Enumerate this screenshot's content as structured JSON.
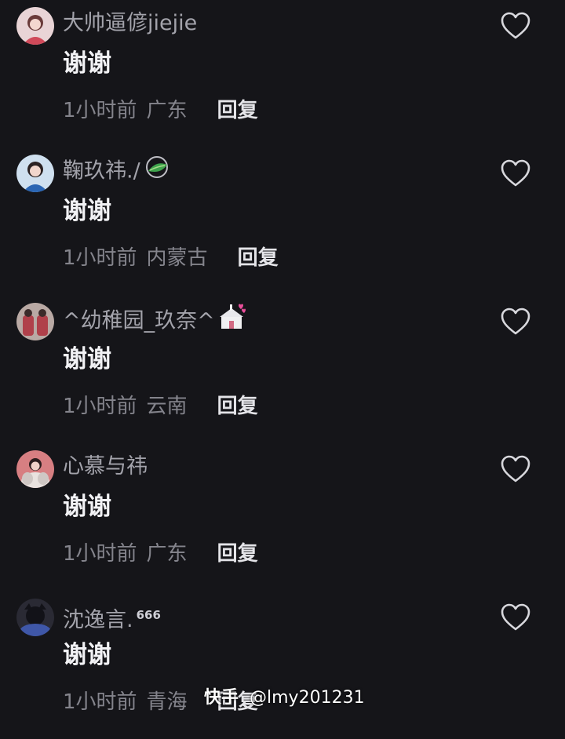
{
  "comments": [
    {
      "username": "大帅逼偐jiejie",
      "text": "谢谢",
      "time": "1小时前",
      "location": "广东",
      "reply": "回复",
      "avatar_icon": "user-avatar-photo"
    },
    {
      "username": "鞠玖祎./",
      "text": "谢谢",
      "time": "1小时前",
      "location": "内蒙古",
      "reply": "回复",
      "avatar_icon": "user-avatar-photo",
      "badge_icon": "green-leaf-icon"
    },
    {
      "username": "^幼稚园_玖奈^",
      "text": "谢谢",
      "time": "1小时前",
      "location": "云南",
      "reply": "回复",
      "avatar_icon": "user-avatar-photo",
      "badge_icon": "wedding-chapel-emoji"
    },
    {
      "username": "心慕与祎",
      "text": "谢谢",
      "time": "1小时前",
      "location": "广东",
      "reply": "回复",
      "avatar_icon": "user-avatar-photo"
    },
    {
      "username": "沈逸言.",
      "username_sup": "666",
      "text": "谢谢",
      "time": "1小时前",
      "location": "青海",
      "reply": "回复",
      "avatar_icon": "user-avatar-photo"
    }
  ],
  "watermark": {
    "brand": "快手",
    "handle": "@lmy201231"
  },
  "colors": {
    "background": "#151519",
    "username": "#a3a3ab",
    "meta": "#84848c",
    "text": "#f2f2f5"
  }
}
